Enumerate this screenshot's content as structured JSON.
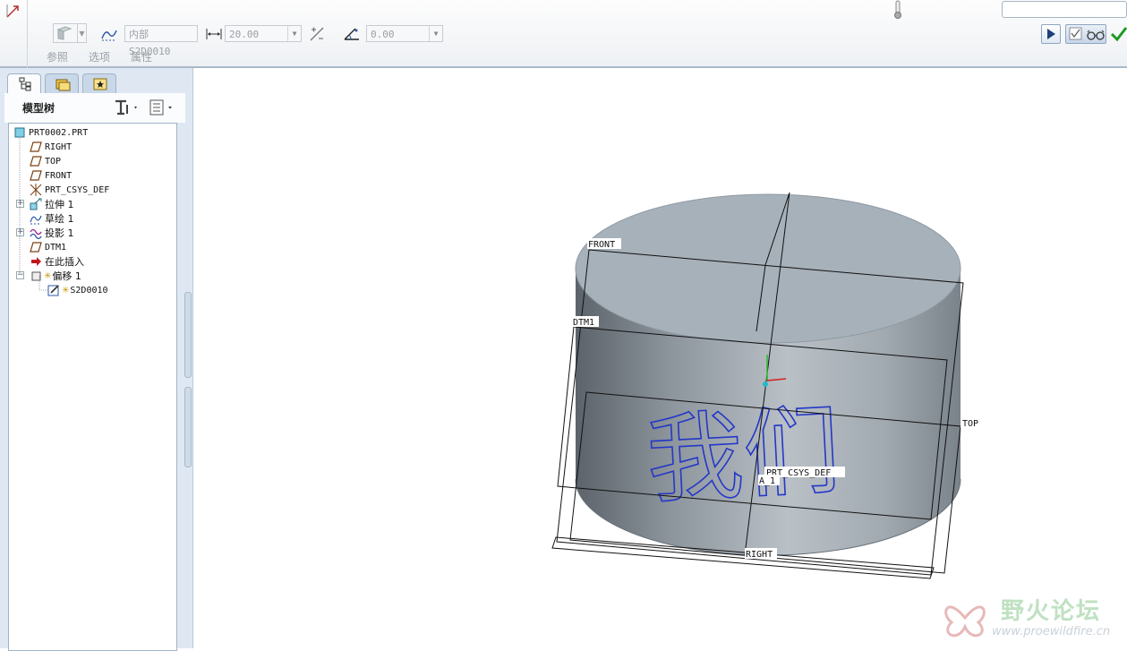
{
  "dashboard": {
    "ref_label": "参照",
    "options_label": "选项",
    "properties_label": "属性",
    "sketch_ref_value": "内部 S2D0010",
    "depth_value": "20.00",
    "angle_value": "0.00"
  },
  "navigator": {
    "tree_title": "模型树",
    "items": [
      {
        "label": "PRT0002.PRT",
        "icon": "part-icon"
      },
      {
        "label": "RIGHT",
        "icon": "datum-plane-icon"
      },
      {
        "label": "TOP",
        "icon": "datum-plane-icon"
      },
      {
        "label": "FRONT",
        "icon": "datum-plane-icon"
      },
      {
        "label": "PRT_CSYS_DEF",
        "icon": "csys-icon"
      },
      {
        "label": "拉伸 1",
        "icon": "extrude-icon"
      },
      {
        "label": "草绘 1",
        "icon": "sketch-icon"
      },
      {
        "label": "投影 1",
        "icon": "project-icon"
      },
      {
        "label": "DTM1",
        "icon": "datum-plane-icon"
      },
      {
        "label": "在此插入",
        "icon": "insert-here-arrow-icon"
      },
      {
        "label": "偏移 1",
        "icon": "offset-icon"
      },
      {
        "label": "S2D0010",
        "icon": "sketch-edit-icon"
      }
    ]
  },
  "model": {
    "engraved_text": "我们",
    "labels": {
      "front": "FRONT",
      "dtm1": "DTM1",
      "top": "TOP",
      "right": "RIGHT",
      "csys": "PRT_CSYS_DEF",
      "axis": "A_1"
    }
  },
  "watermark": {
    "title": "野火论坛",
    "url": "www.proewildfire.cn"
  },
  "colors": {
    "accent": "#1f5fa8",
    "confirm": "#1e9a23",
    "cylinder_top": "#a7b1ba",
    "engrave": "#2437c8"
  }
}
